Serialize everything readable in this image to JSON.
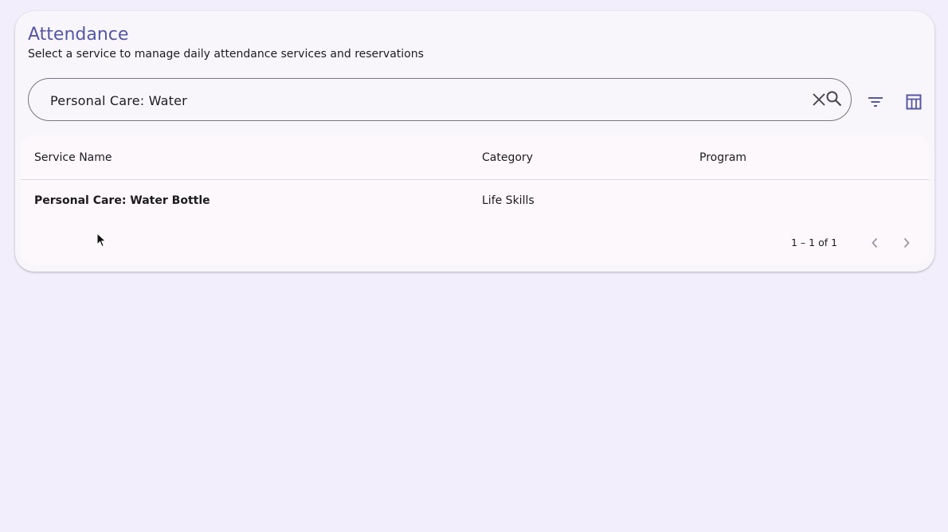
{
  "page": {
    "title": "Attendance",
    "subtitle": "Select a service to manage daily attendance services and reservations"
  },
  "search": {
    "value": "Personal Care: Water",
    "clear_icon": "close-icon",
    "search_icon": "search-icon"
  },
  "toolbar": {
    "filter_icon": "filter-icon",
    "columns_icon": "table-columns-icon"
  },
  "table": {
    "columns": [
      "Service Name",
      "Category",
      "Program"
    ],
    "rows": [
      {
        "service_name": "Personal Care: Water Bottle",
        "category": "Life Skills",
        "program": ""
      }
    ]
  },
  "paginator": {
    "range_label": "1 – 1 of 1",
    "prev_icon": "chevron-left-icon",
    "next_icon": "chevron-right-icon"
  },
  "colors": {
    "accent": "#5457a6",
    "background": "#f2eefb",
    "card": "#f9f6fb"
  }
}
